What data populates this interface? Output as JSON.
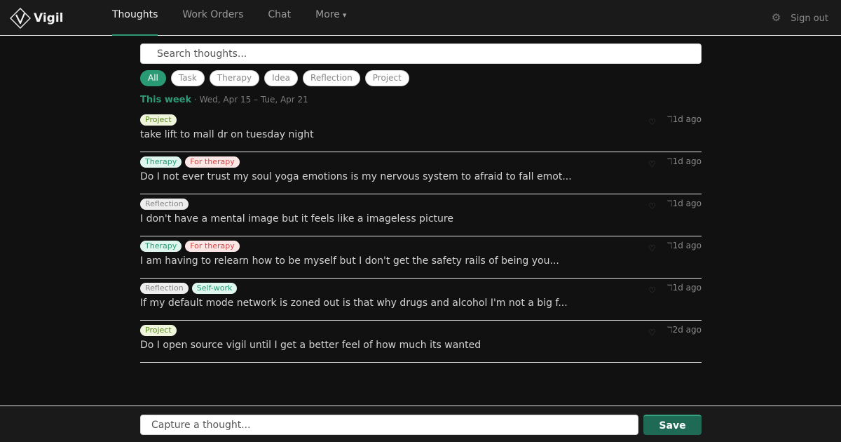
{
  "app": {
    "name": "Vigil"
  },
  "nav": {
    "tabs": [
      {
        "label": "Thoughts",
        "active": true
      },
      {
        "label": "Work Orders",
        "active": false
      },
      {
        "label": "Chat",
        "active": false
      }
    ],
    "more_label": "More",
    "more_caret": "▾"
  },
  "header": {
    "settings_icon": "gear-icon",
    "settings_glyph": "⚙",
    "sign_out": "Sign out"
  },
  "search": {
    "placeholder": "Search thoughts..."
  },
  "filters": [
    "All",
    "Task",
    "Therapy",
    "Idea",
    "Reflection",
    "Project"
  ],
  "active_filter": "All",
  "week": {
    "label": "This week",
    "range": " · Wed, Apr 15 – Tue, Apr 21"
  },
  "thoughts": [
    {
      "tags": [
        {
          "label": "Project",
          "kind": "project"
        }
      ],
      "text": "take lift to mall dr on tuesday night",
      "time": "1d ago"
    },
    {
      "tags": [
        {
          "label": "Therapy",
          "kind": "therapy"
        },
        {
          "label": "For therapy",
          "kind": "fortherapy"
        }
      ],
      "text": "Do I not ever trust my soul yoga emotions is my nervous system to afraid to fall emot...",
      "time": "1d ago"
    },
    {
      "tags": [
        {
          "label": "Reflection",
          "kind": "reflection"
        }
      ],
      "text": "I don't have a mental image but it feels like a imageless picture",
      "time": "1d ago"
    },
    {
      "tags": [
        {
          "label": "Therapy",
          "kind": "therapy"
        },
        {
          "label": "For therapy",
          "kind": "fortherapy"
        }
      ],
      "text": "I am having to relearn how to be myself but I don't get the safety rails of being you...",
      "time": "1d ago"
    },
    {
      "tags": [
        {
          "label": "Reflection",
          "kind": "reflection"
        },
        {
          "label": "Self-work",
          "kind": "selfwork"
        }
      ],
      "text": "If my default mode network is zoned out is that why drugs and alcohol I'm not a big f...",
      "time": "1d ago"
    },
    {
      "tags": [
        {
          "label": "Project",
          "kind": "project"
        }
      ],
      "text": "Do I open source vigil until I get a better feel of how much its wanted",
      "time": "2d ago"
    }
  ],
  "row_icons": {
    "heart": "♡",
    "link": "ℸ"
  },
  "composer": {
    "placeholder": "Capture a thought...",
    "save_label": "Save"
  },
  "colors": {
    "accent": "#2a9a74",
    "save": "#1e6a55",
    "background": "#111111"
  }
}
